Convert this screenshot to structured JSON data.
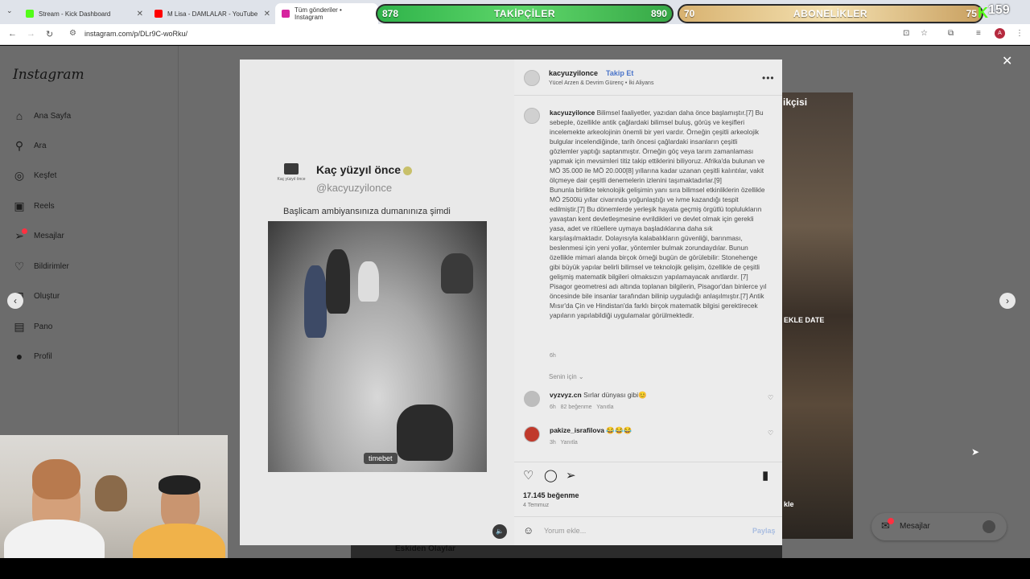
{
  "browser": {
    "tabs": [
      {
        "label": "Stream - Kick Dashboard",
        "favicon_color": "#53fc18"
      },
      {
        "label": "M Lisa - DAMLALAR - YouTube",
        "favicon_color": "#ff0000"
      },
      {
        "label": "Tüm gönderiler • Instagram",
        "favicon_color": "#d6249f"
      }
    ],
    "url": "instagram.com/p/DLr9C-woRku/",
    "profile_initial": "A"
  },
  "overlay": {
    "followers": {
      "label": "TAKİPÇİLER",
      "current": "878",
      "goal": "890"
    },
    "subscribers": {
      "label": "ABONELİKLER",
      "current": "70",
      "goal": "75"
    },
    "viewer_count": "159"
  },
  "sidebar": {
    "logo": "Instagram",
    "items": [
      {
        "label": "Ana Sayfa",
        "icon": "home-icon"
      },
      {
        "label": "Ara",
        "icon": "search-icon"
      },
      {
        "label": "Keşfet",
        "icon": "compass-icon"
      },
      {
        "label": "Reels",
        "icon": "reels-icon"
      },
      {
        "label": "Mesajlar",
        "icon": "messenger-icon"
      },
      {
        "label": "Bildirimler",
        "icon": "heart-icon"
      },
      {
        "label": "Oluştur",
        "icon": "plus-icon"
      },
      {
        "label": "Pano",
        "icon": "dashboard-icon"
      },
      {
        "label": "Profil",
        "icon": "profile-icon"
      }
    ]
  },
  "media": {
    "title": "Kaç yüzyıl önce",
    "handle": "@kacyuzyilonce",
    "logo_caption": "Kaç yüzyıl önce",
    "caption": "Başlicam ambiyansınıza dumanınıza şimdi",
    "watermark": "timebet"
  },
  "post": {
    "username": "kacyuzyilonce",
    "follow_label": "Takip Et",
    "subtitle": "Yücel Arzen & Devrim Gürenç • İki Aliyans",
    "caption_user": "kacyuzyilonce",
    "caption_text": "Bilimsel faaliyetler, yazıdan daha önce başlamıştır.[7] Bu sebeple, özellikle antik çağlardaki bilimsel buluş, görüş ve keşifleri incelemekte arkeolojinin önemli bir yeri vardır. Örneğin çeşitli arkeolojik bulgular incelendiğinde, tarih öncesi çağlardaki insanların çeşitli gözlemler yaptığı saptanmıştır. Örneğin göç veya tarım zamanlaması yapmak için mevsimleri titiz takip ettiklerini biliyoruz. Afrika'da bulunan ve MÖ 35.000 ile MÖ 20.000[8] yıllarına kadar uzanan çeşitli kalıntılar, vakit ölçmeye dair çeşitli denemelerin izlenini taşımaktadırlar.[9]",
    "caption_text_2": "Bununla birlikte teknolojik gelişimin yanı sıra bilimsel etkinliklerin özellikle MÖ 2500lü yıllar civarında yoğunlaştığı ve ivme kazandığı tespit edilmiştir.[7] Bu dönemlerde yerleşik hayata geçmiş örgütlü toplulukların yavaştan kent devletleşmesine evrildikleri ve devlet olmak için gerekli yasa, adet ve ritüellere uymaya başladıklarına daha sık karşılaşılmaktadır. Dolayısıyla kalabalıkların güvenliği, barınması, beslenmesi için yeni yollar, yöntemler bulmak zorundaydılar. Bunun özellikle mimari alanda birçok örneği bugün de görülebilir: Stonehenge gibi büyük yapılar belirli bilimsel ve teknolojik gelişim, özellikle de çeşitli gelişmiş matematik bilgileri olmaksızın yapılamayacak anıtlardır. [7] Pisagor geometresi adı altında toplanan bilgilerin, Pisagor'dan binlerce yıl öncesinde bile insanlar tarafından bilinip uyguladığı anlaşılmıştır.[7] Antik Mısır'da Çin ve Hindistan'da farklı birçok matematik bilgisi gerektirecek yapıların yapılabildiği uygulamalar görülmektedir.",
    "caption_time": "6h",
    "comment_filter": "Senin için",
    "comments": [
      {
        "user": "vyzvyz.cn",
        "text": "Sırlar dünyası gibi😊",
        "time": "6h",
        "likes": "82 beğenme",
        "reply": "Yanıtla"
      },
      {
        "user": "pakize_israfilova",
        "text": "😂😂😂",
        "time": "3h",
        "likes": "",
        "reply": "Yanıtla"
      }
    ],
    "likes": "17.145 beğenme",
    "date": "4 Temmuz",
    "comment_placeholder": "Yorum ekle...",
    "post_button": "Paylaş"
  },
  "background": {
    "label_top": "ikçisi",
    "label_mid": "EKLE DATE",
    "label_low": "kle",
    "bottom_title": "Eskiden Olaylar"
  },
  "messages_pill": {
    "label": "Mesajlar"
  }
}
